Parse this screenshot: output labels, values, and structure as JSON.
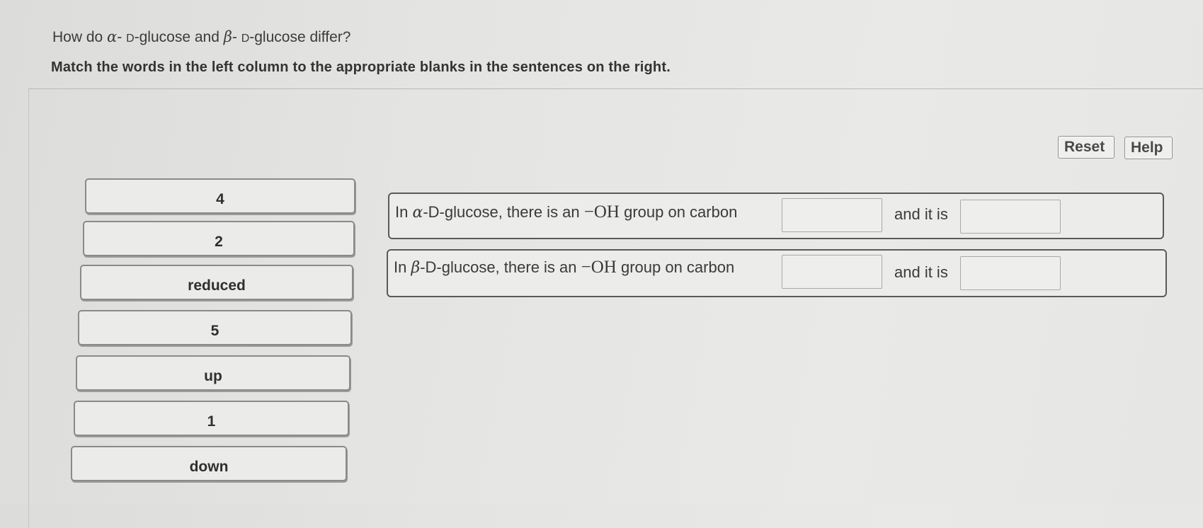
{
  "question": {
    "prefix": "How do ",
    "alpha": "α",
    "mid1": "- ",
    "d1": "D",
    "mid2": "-glucose and ",
    "beta": "β",
    "mid3": "- ",
    "d2": "D",
    "suffix": "-glucose differ?"
  },
  "instruction": "Match the words in the left column to the appropriate blanks in the sentences on the right.",
  "toolbar": {
    "reset_label": "Reset",
    "help_label": "Help"
  },
  "word_bank": [
    "4",
    "2",
    "reduced",
    "5",
    "up",
    "1",
    "down"
  ],
  "sentences": [
    {
      "intro": "In ",
      "greek": "α",
      "rest": "-D-glucose, there is an ",
      "oh": "−OH",
      "after": " group on carbon",
      "middle": "and it is"
    },
    {
      "intro": "In ",
      "greek": "β",
      "rest": "-D-glucose, there is an ",
      "oh": "−OH",
      "after": " group on carbon",
      "middle": "and it is"
    }
  ]
}
